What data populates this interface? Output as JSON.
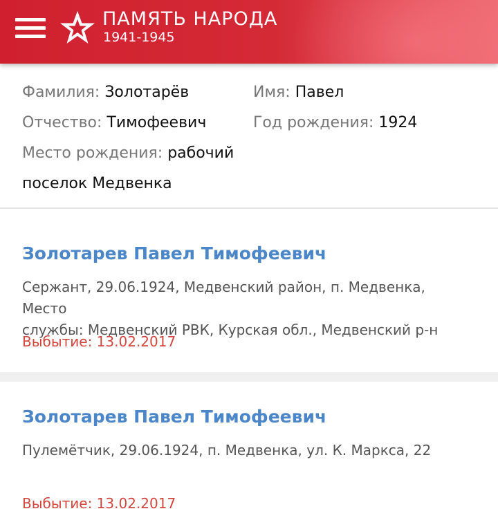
{
  "header": {
    "title": "ПАМЯТЬ НАРОДА",
    "years": "1941-1945",
    "colors": {
      "primary": "#d0202f"
    }
  },
  "info": {
    "surname": {
      "label": "Фамилия:",
      "value": "Золотарёв"
    },
    "name": {
      "label": "Имя:",
      "value": "Павел"
    },
    "patronymic": {
      "label": "Отчество:",
      "value": "Тимофеевич"
    },
    "birth_year": {
      "label": "Год рождения:",
      "value": "1924"
    },
    "birth_place": {
      "label": "Место рождения:",
      "value_line1": "рабочий",
      "value_line2": "поселок Медвенка"
    }
  },
  "records": [
    {
      "title": "Золотарев Павел Тимофеевич",
      "desc_line1": "Сержант, 29.06.1924, Медвенский район, п. Медвенка, Место",
      "desc_line2": "службы: Медвенский РВК, Курская обл., Медвенский р-н",
      "out": "Выбытие: 13.02.2017"
    },
    {
      "title": "Золотарев Павел Тимофеевич",
      "desc_line1": "Пулемётчик, 29.06.1924, п. Медвенка, ул. К. Маркса, 22",
      "out": "Выбытие: 13.02.2017"
    }
  ]
}
